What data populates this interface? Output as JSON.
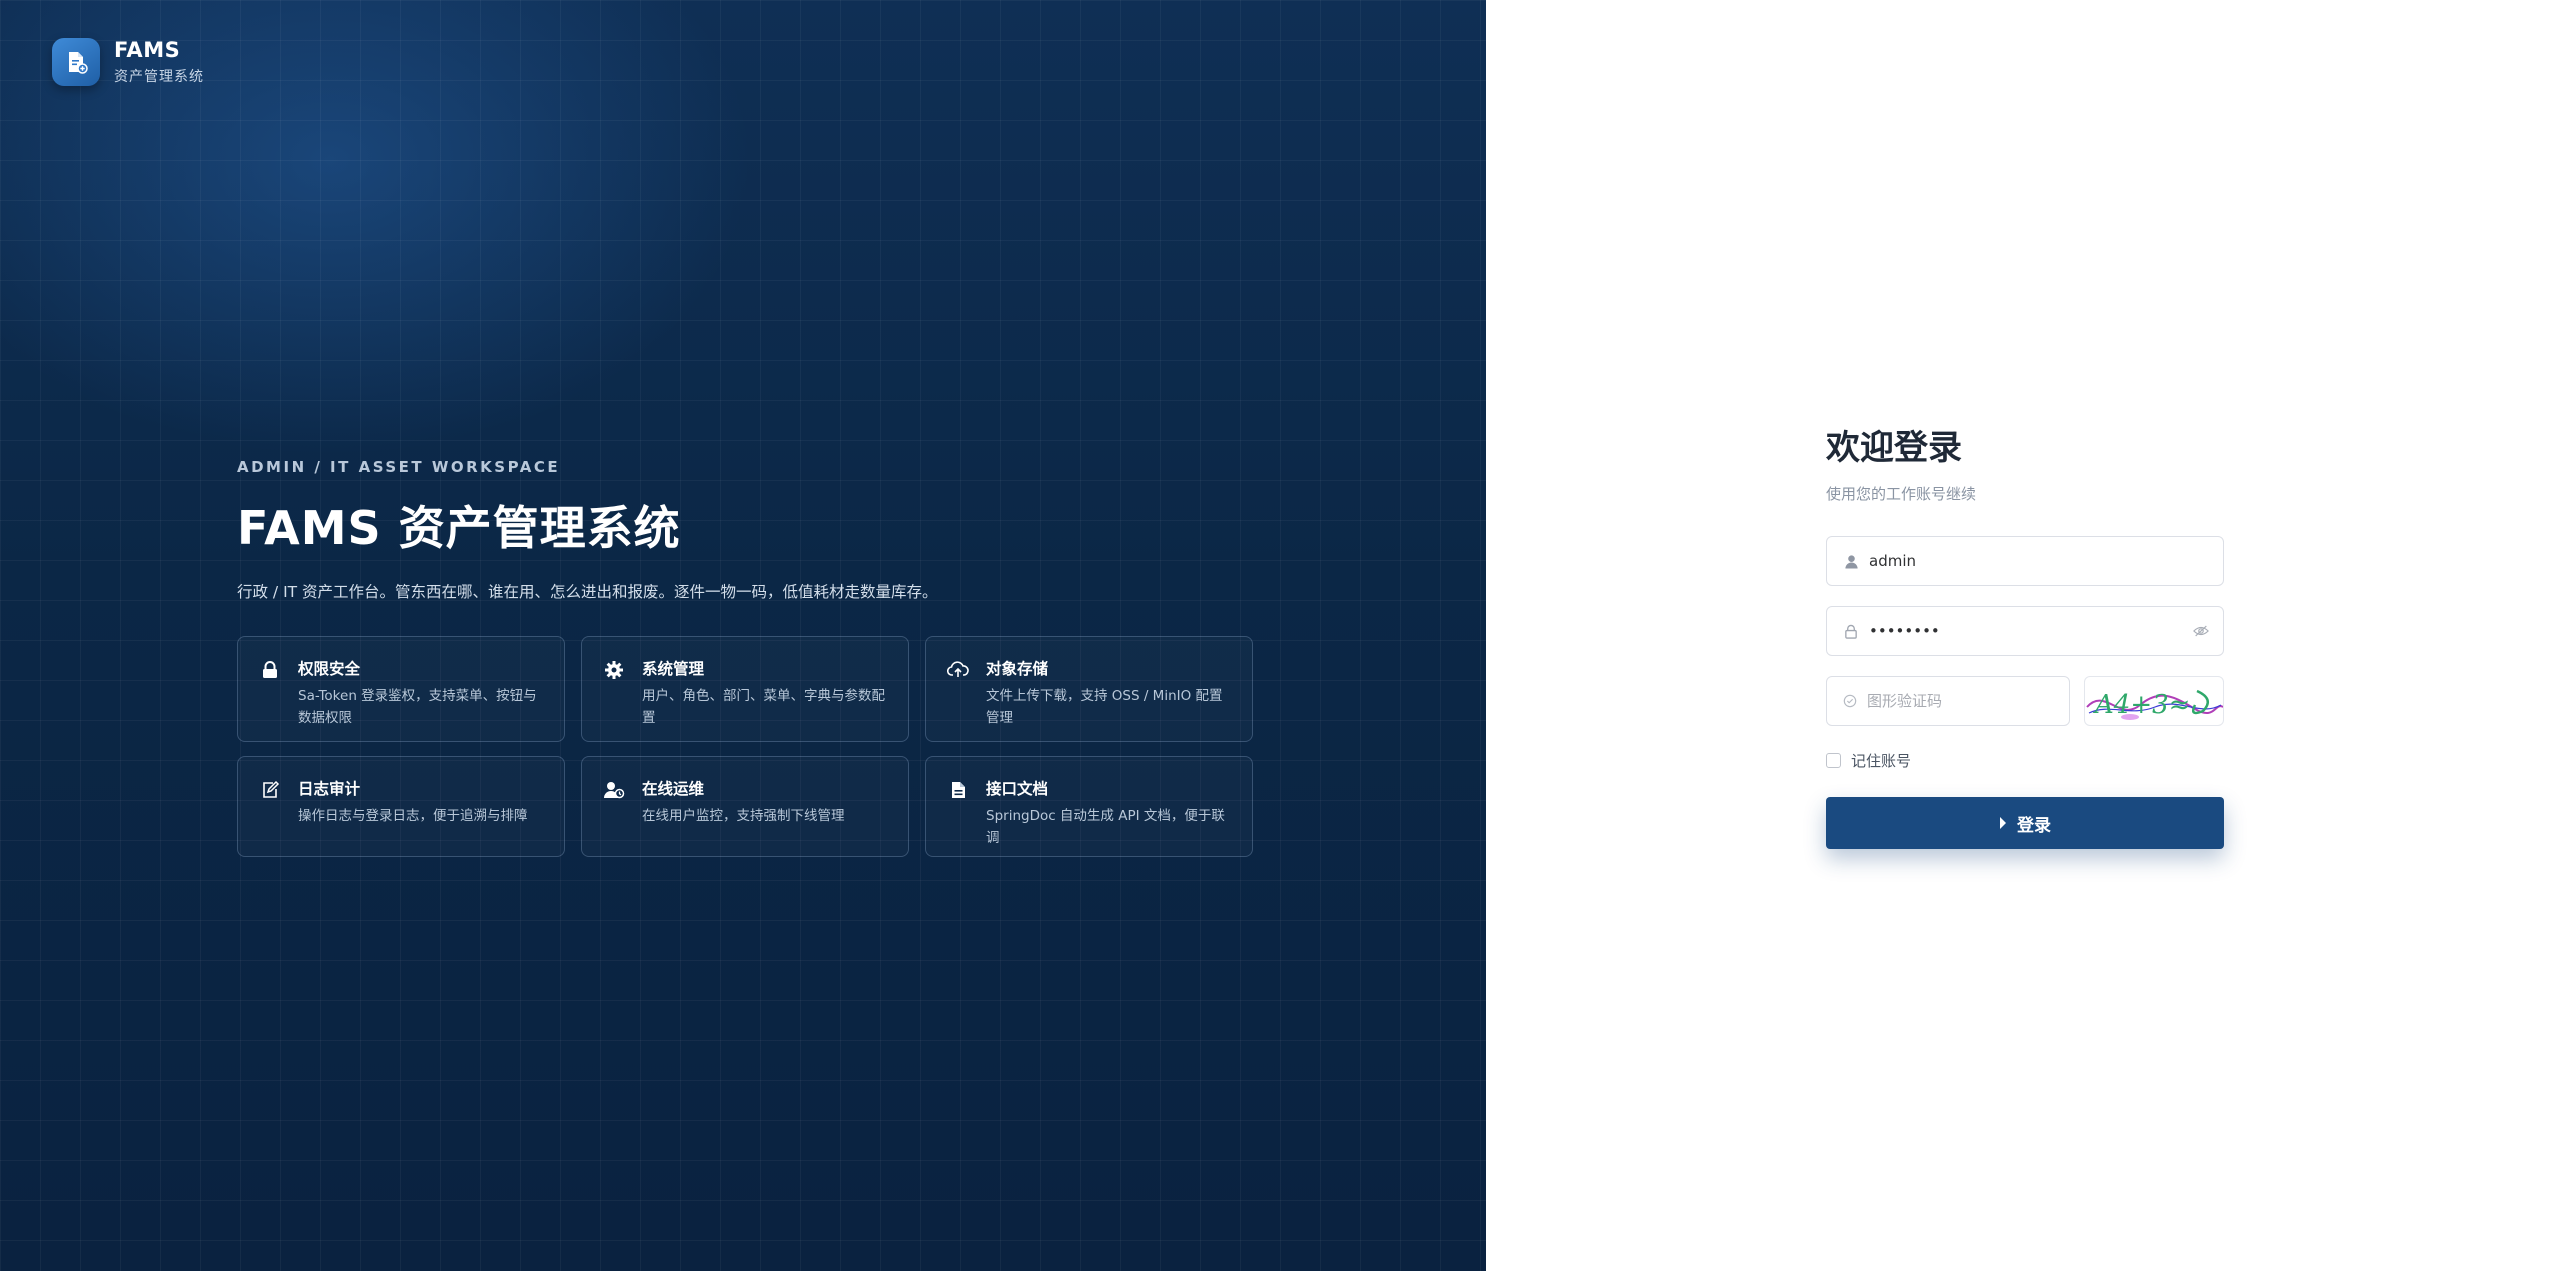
{
  "brand": {
    "name": "FAMS",
    "subtitle": "资产管理系统",
    "logo_icon": "document-box-icon"
  },
  "hero": {
    "eyebrow": "ADMIN / IT ASSET WORKSPACE",
    "title": "FAMS 资产管理系统",
    "description": "行政 / IT 资产工作台。管东西在哪、谁在用、怎么进出和报废。逐件一物一码，低值耗材走数量库存。"
  },
  "features": [
    {
      "icon": "lock-icon",
      "title": "权限安全",
      "desc": "Sa-Token 登录鉴权，支持菜单、按钮与数据权限"
    },
    {
      "icon": "gear-icon",
      "title": "系统管理",
      "desc": "用户、角色、部门、菜单、字典与参数配置"
    },
    {
      "icon": "cloud-upload-icon",
      "title": "对象存储",
      "desc": "文件上传下载，支持 OSS / MinIO 配置管理"
    },
    {
      "icon": "edit-log-icon",
      "title": "日志审计",
      "desc": "操作日志与登录日志，便于追溯与排障"
    },
    {
      "icon": "online-user-icon",
      "title": "在线运维",
      "desc": "在线用户监控，支持强制下线管理"
    },
    {
      "icon": "document-icon",
      "title": "接口文档",
      "desc": "SpringDoc 自动生成 API 文档，便于联调"
    }
  ],
  "login": {
    "title": "欢迎登录",
    "subtitle": "使用您的工作账号继续",
    "username": {
      "value": "admin",
      "icon": "user-icon"
    },
    "password": {
      "value": "admin123",
      "icon": "lock-icon",
      "toggle_icon": "eye-hidden-icon"
    },
    "captcha": {
      "placeholder": "图形验证码",
      "icon": "shield-check-icon",
      "image_text": "A4+3≈"
    },
    "remember_label": "记住账号",
    "remember_checked": false,
    "submit_label": "登录",
    "submit_icon": "caret-right-icon"
  },
  "colors": {
    "panel_dark": "#0b2746",
    "accent": "#1a4a80",
    "logo": "#2f78c8"
  }
}
